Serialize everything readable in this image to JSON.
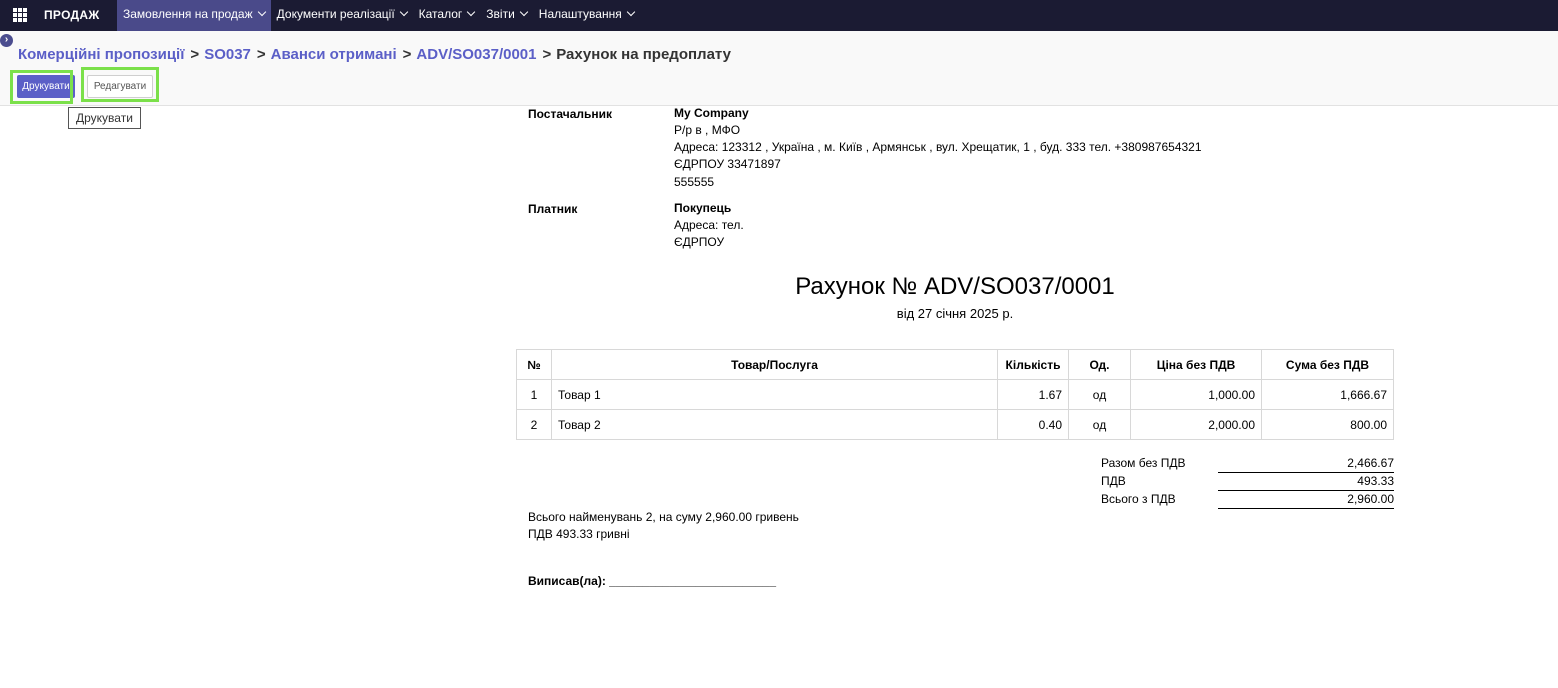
{
  "topbar": {
    "app_name": "ПРОДАЖ",
    "menu": [
      {
        "label": "Замовлення на продаж"
      },
      {
        "label": "Документи реалізації"
      },
      {
        "label": "Каталог"
      },
      {
        "label": "Звіти"
      },
      {
        "label": "Налаштування"
      }
    ]
  },
  "breadcrumb": {
    "items": [
      "Комерційні пропозиції",
      "SO037",
      "Аванси отримані",
      "ADV/SO037/0001"
    ],
    "current": "Рахунок на предоплату"
  },
  "toolbar": {
    "print_label": "Друкувати",
    "edit_label": "Редагувати",
    "tooltip": "Друкувати"
  },
  "invoice": {
    "supplier_label": "Постачальник",
    "supplier_name": "My Company",
    "supplier_bank": "Р/р в , МФО",
    "supplier_address": "Адреса: 123312 , Україна , м. Київ , Армянськ , вул. Хрещатик, 1 , буд. 333 тел. +380987654321",
    "supplier_edrpou": "ЄДРПОУ 33471897",
    "supplier_extra": "555555",
    "payer_label": "Платник",
    "payer_name": "Покупець",
    "payer_address": "Адреса: тел.",
    "payer_edrpou": "ЄДРПОУ",
    "title": "Рахунок № ADV/SO037/0001",
    "date": "від 27 січня 2025 р.",
    "table": {
      "headers": [
        "№",
        "Товар/Послуга",
        "Кількість",
        "Од.",
        "Ціна без ПДВ",
        "Сума без ПДВ"
      ],
      "rows": [
        [
          "1",
          "Товар 1",
          "1.67",
          "од",
          "1,000.00",
          "1,666.67"
        ],
        [
          "2",
          "Товар 2",
          "0.40",
          "од",
          "2,000.00",
          "800.00"
        ]
      ]
    },
    "totals": [
      {
        "label": "Разом без ПДВ",
        "value": "2,466.67"
      },
      {
        "label": "ПДВ",
        "value": "493.33"
      },
      {
        "label": "Всього з ПДВ",
        "value": "2,960.00"
      }
    ],
    "summary_line1": "Всього найменувань 2, на суму 2,960.00 гривень",
    "summary_line2": "ПДВ 493.33 гривні",
    "signature": "Виписав(ла): _________________________"
  }
}
